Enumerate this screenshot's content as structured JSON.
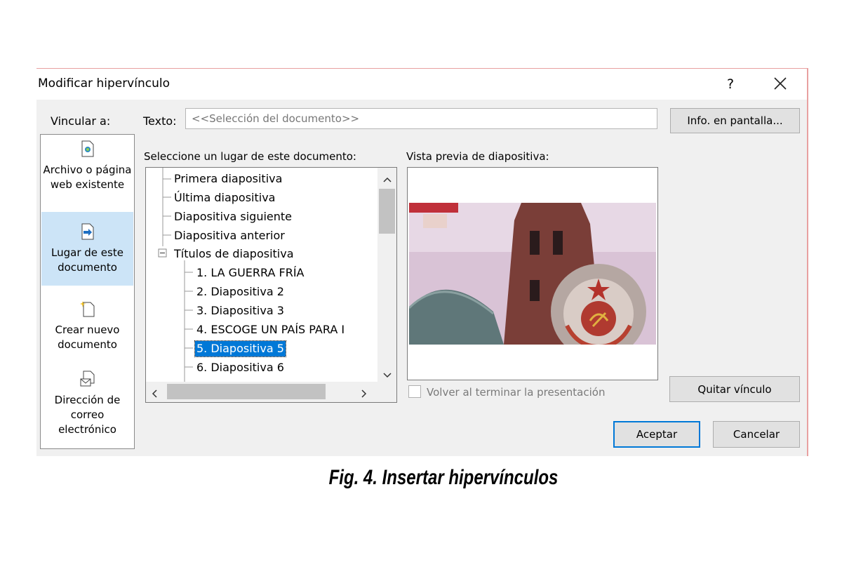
{
  "dialog": {
    "title": "Modificar hipervínculo",
    "help_label": "?",
    "link_to_label": "Vincular a:",
    "link_options": [
      {
        "label": "Archivo o página web existente",
        "icon": "existing-file-icon",
        "selected": false
      },
      {
        "label": "Lugar de este documento",
        "icon": "place-in-document-icon",
        "selected": true
      },
      {
        "label": "Crear nuevo documento",
        "icon": "new-document-icon",
        "selected": false
      },
      {
        "label": "Dirección de correo electrónico",
        "icon": "email-address-icon",
        "selected": false
      }
    ],
    "text_label": "Texto:",
    "text_value": "<<Selección del documento>>",
    "screentip_button": "Info. en pantalla...",
    "place_label": "Seleccione un lugar de este documento:",
    "tree_items": [
      "Primera diapositiva",
      "Última diapositiva",
      "Diapositiva siguiente",
      "Diapositiva anterior",
      "Títulos de diapositiva",
      "1. LA GUERRA FRÍA",
      "2. Diapositiva 2",
      "3. Diapositiva 3",
      "4. ESCOGE UN PAÍS PARA I",
      "5. Diapositiva 5",
      "6. Diapositiva 6"
    ],
    "selected_item": "5. Diapositiva 5",
    "preview_label": "Vista previa de diapositiva:",
    "return_checkbox_label": "Volver al terminar la presentación",
    "remove_link_button": "Quitar vínculo",
    "ok_button": "Aceptar",
    "cancel_button": "Cancelar"
  },
  "caption": "Fig. 4. Insertar hipervínculos",
  "colors": {
    "dialog_bg": "#f0f0f0",
    "selection": "#0078d7",
    "nav_selected": "#cce4f7",
    "window_border": "#e8a0a0"
  }
}
